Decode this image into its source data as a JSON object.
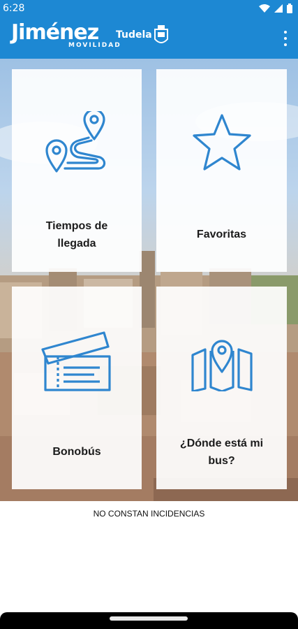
{
  "status": {
    "time": "6:28"
  },
  "appbar": {
    "brand": "Jiménez",
    "brand_sub": "MOVILIDAD",
    "city": "Tudela"
  },
  "tiles": [
    {
      "label": "Tiempos de llegada",
      "icon": "route-icon"
    },
    {
      "label": "Favoritas",
      "icon": "star-icon"
    },
    {
      "label": "Bonobús",
      "icon": "ticket-icon"
    },
    {
      "label": "¿Dónde está mi bus?",
      "icon": "map-pin-icon"
    }
  ],
  "notice": "NO CONSTAN INCIDENCIAS",
  "colors": {
    "primary": "#1d88d3",
    "icon": "#2f86cf"
  }
}
